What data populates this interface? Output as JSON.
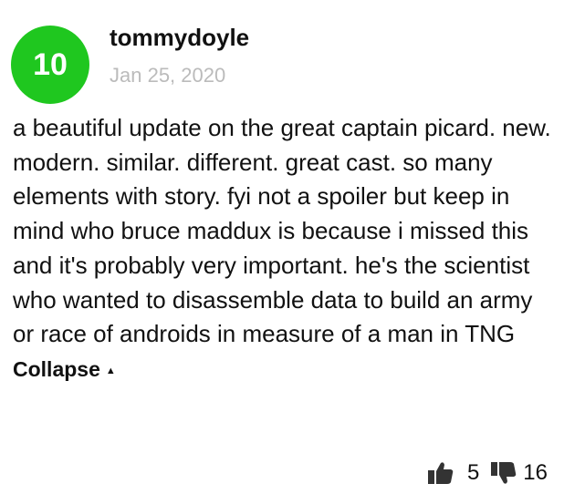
{
  "review": {
    "score": "10",
    "score_color": "#1fc71f",
    "author": "tommydoyle",
    "date": "Jan 25, 2020",
    "text": "a beautiful update on the great captain picard. new. modern. similar. different. great cast. so many elements with story. fyi not a spoiler but keep in mind who bruce maddux is because i missed this and it's probably very important. he's the scientist who wanted to disassemble data to build an army or race of androids in measure of a man in TNG",
    "collapse_label": "Collapse",
    "collapse_icon": "caret-up-icon"
  },
  "votes": {
    "up_icon": "thumbs-up-icon",
    "up_count": "5",
    "down_icon": "thumbs-down-icon",
    "down_count": "16"
  }
}
